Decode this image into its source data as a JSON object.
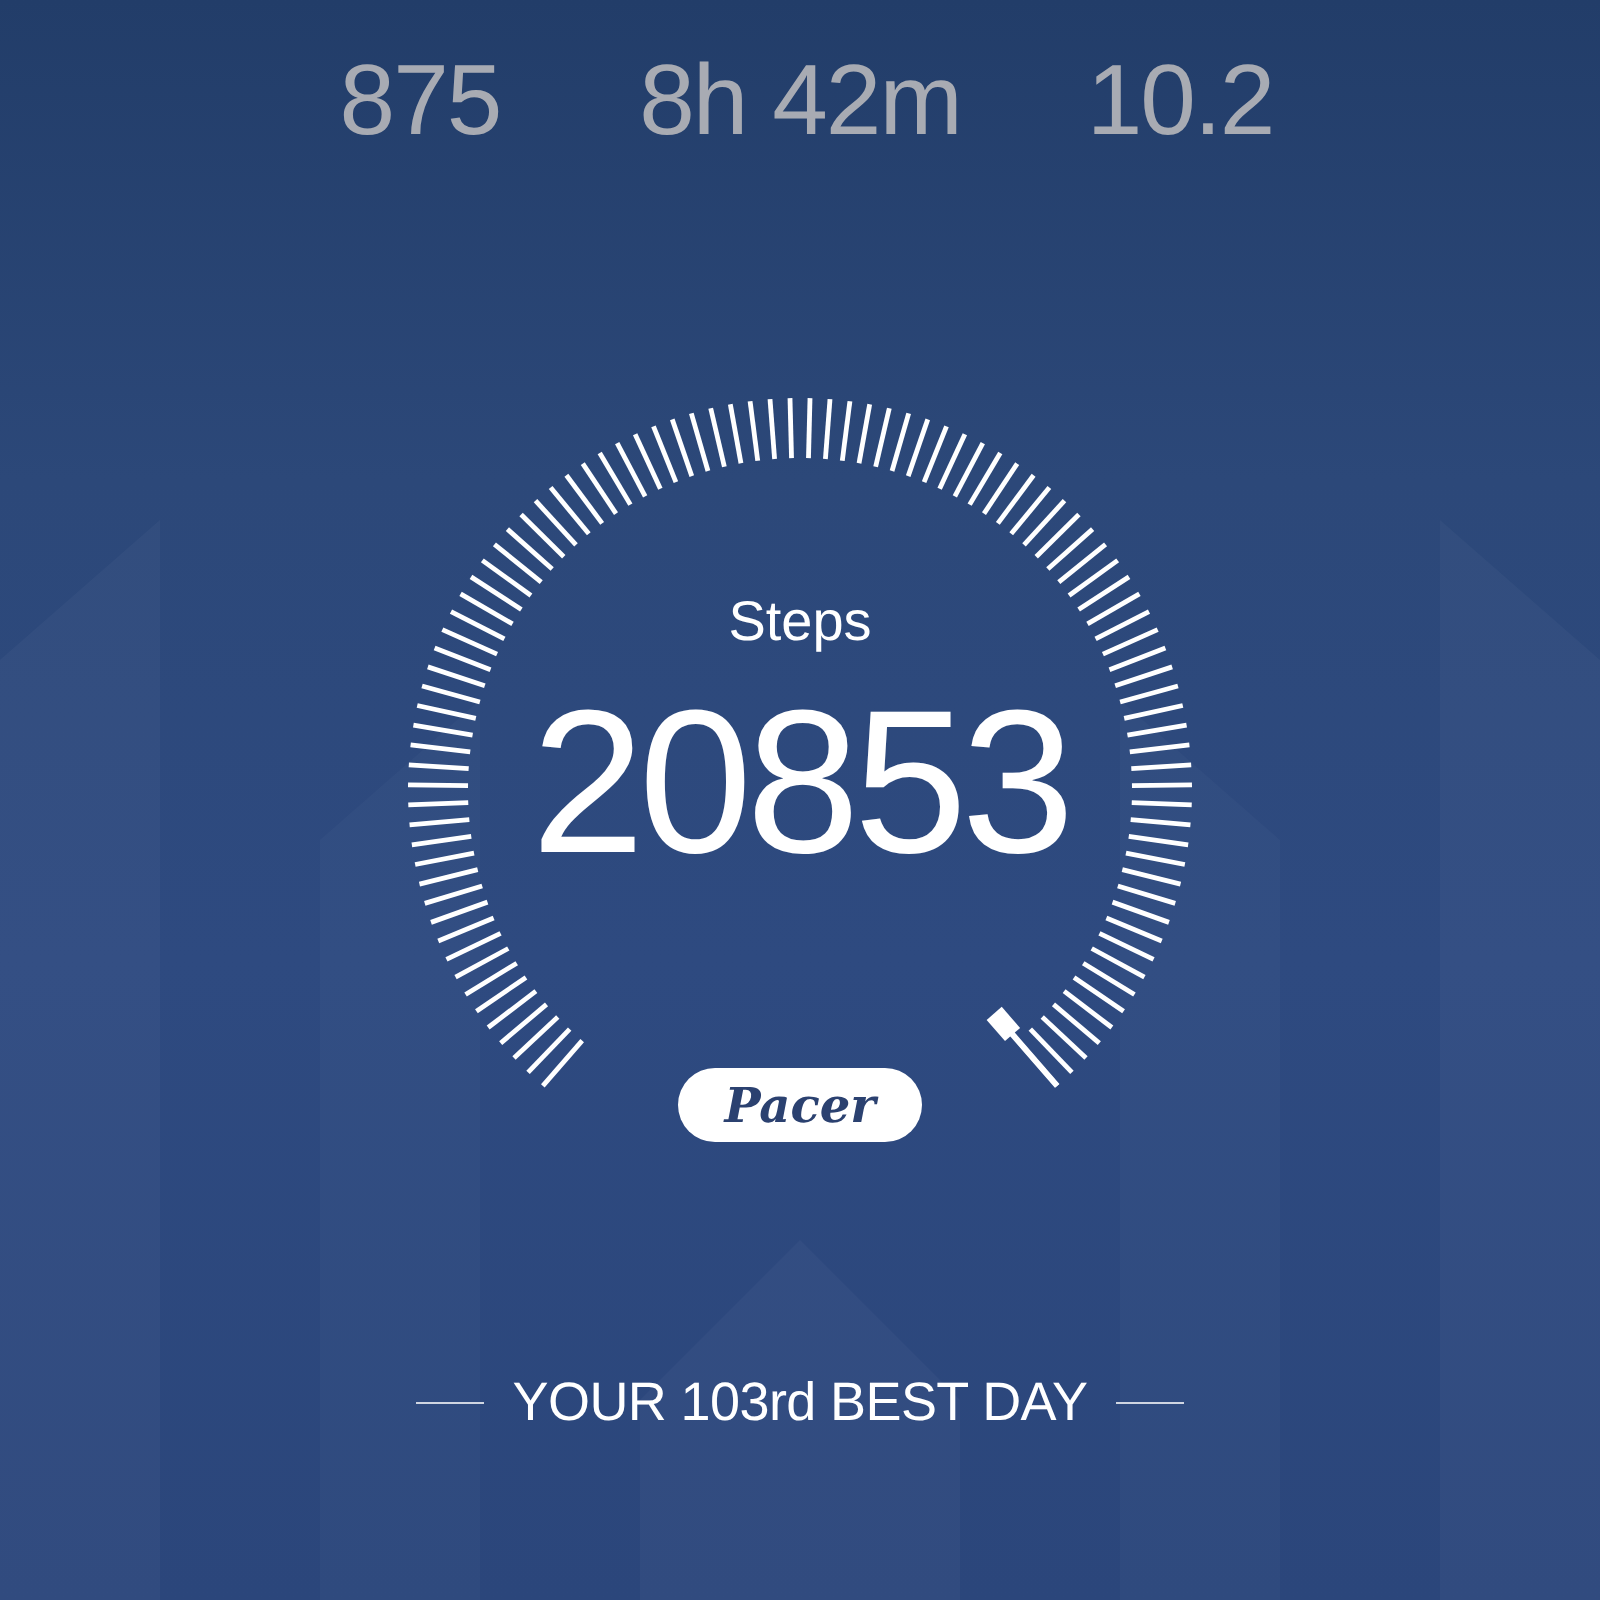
{
  "stats": [
    {
      "value": "875"
    },
    {
      "value": "8h 42m"
    },
    {
      "value": "10.2"
    }
  ],
  "gauge": {
    "label": "Steps",
    "value": "20853",
    "logo": "Pacer"
  },
  "best_day": "YOUR 103rd BEST DAY"
}
